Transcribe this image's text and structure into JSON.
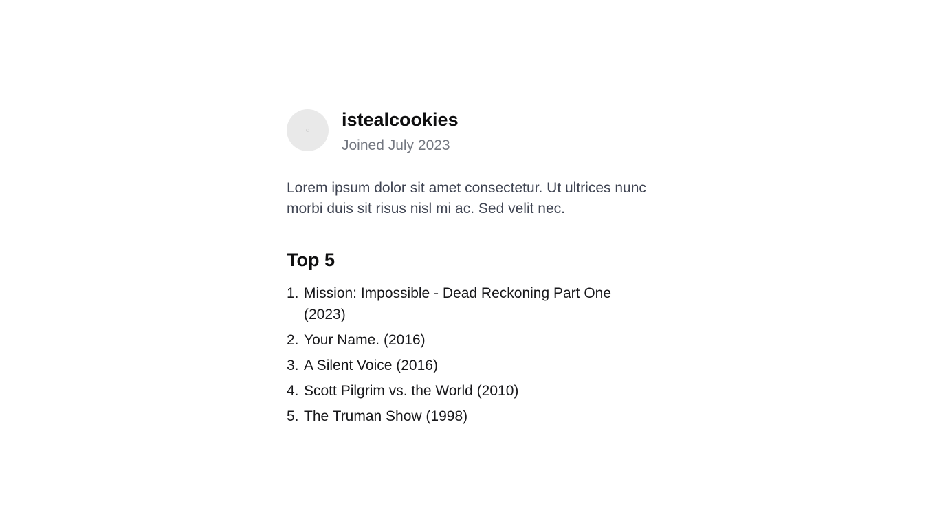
{
  "profile": {
    "username": "istealcookies",
    "joined": "Joined July 2023",
    "bio": "Lorem ipsum dolor sit amet consectetur. Ut ultrices nunc morbi duis sit risus nisl mi ac. Sed velit nec."
  },
  "top": {
    "heading": "Top 5",
    "items": [
      {
        "num": "1.",
        "title": "Mission: Impossible - Dead Reckoning Part One (2023)"
      },
      {
        "num": "2.",
        "title": "Your Name. (2016)"
      },
      {
        "num": "3.",
        "title": "A Silent Voice (2016)"
      },
      {
        "num": "4.",
        "title": "Scott Pilgrim vs. the World (2010)"
      },
      {
        "num": "5.",
        "title": "The Truman Show (1998)"
      }
    ]
  }
}
